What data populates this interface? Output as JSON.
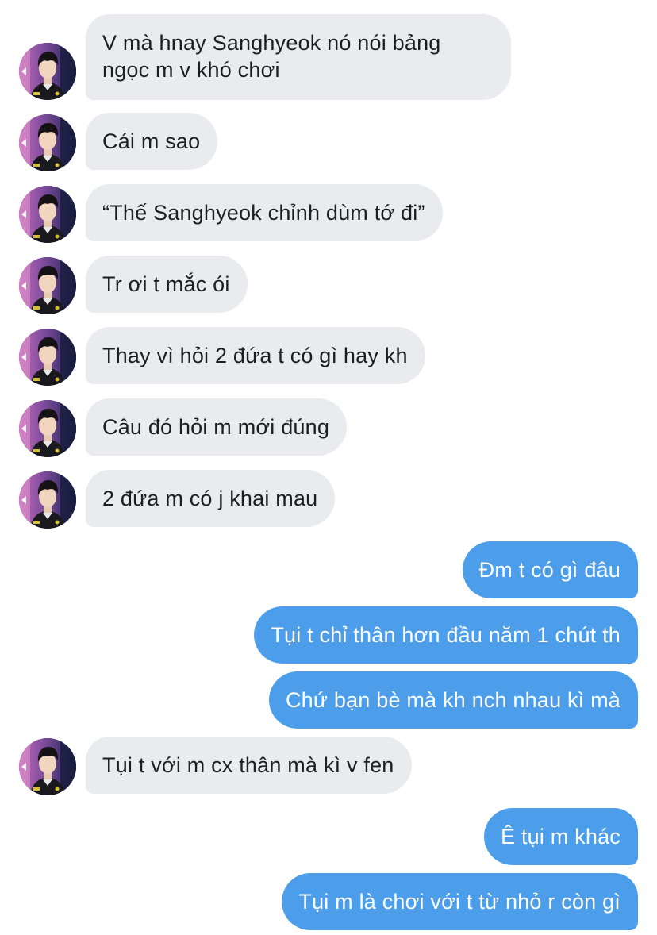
{
  "contact": {
    "avatar_icon": "profile-photo-avatar"
  },
  "colors": {
    "incoming_bubble": "#e9ebef",
    "outgoing_bubble": "#4c9eeb",
    "background": "#ffffff"
  },
  "messages": [
    {
      "side": "in",
      "text": "V mà hnay Sanghyeok nó nói bảng ngọc m v khó chơi"
    },
    {
      "side": "in",
      "text": "Cái m sao"
    },
    {
      "side": "in",
      "text": "“Thế Sanghyeok chỉnh dùm tớ đi”"
    },
    {
      "side": "in",
      "text": "Tr ơi t mắc ói"
    },
    {
      "side": "in",
      "text": "Thay vì hỏi 2 đứa t có gì hay kh"
    },
    {
      "side": "in",
      "text": "Câu đó hỏi m mới đúng"
    },
    {
      "side": "in",
      "text": "2 đứa m có j khai mau"
    },
    {
      "side": "out",
      "text": "Đm t có gì đâu"
    },
    {
      "side": "out",
      "text": "Tụi t chỉ thân hơn đầu năm 1 chút th"
    },
    {
      "side": "out",
      "text": "Chứ bạn bè mà kh nch nhau kì mà"
    },
    {
      "side": "in",
      "text": "Tụi t với m cx thân mà kì v fen"
    },
    {
      "side": "out",
      "text": "Ê tụi m khác"
    },
    {
      "side": "out",
      "text": "Tụi m là chơi với t từ nhỏ r còn gì"
    }
  ]
}
